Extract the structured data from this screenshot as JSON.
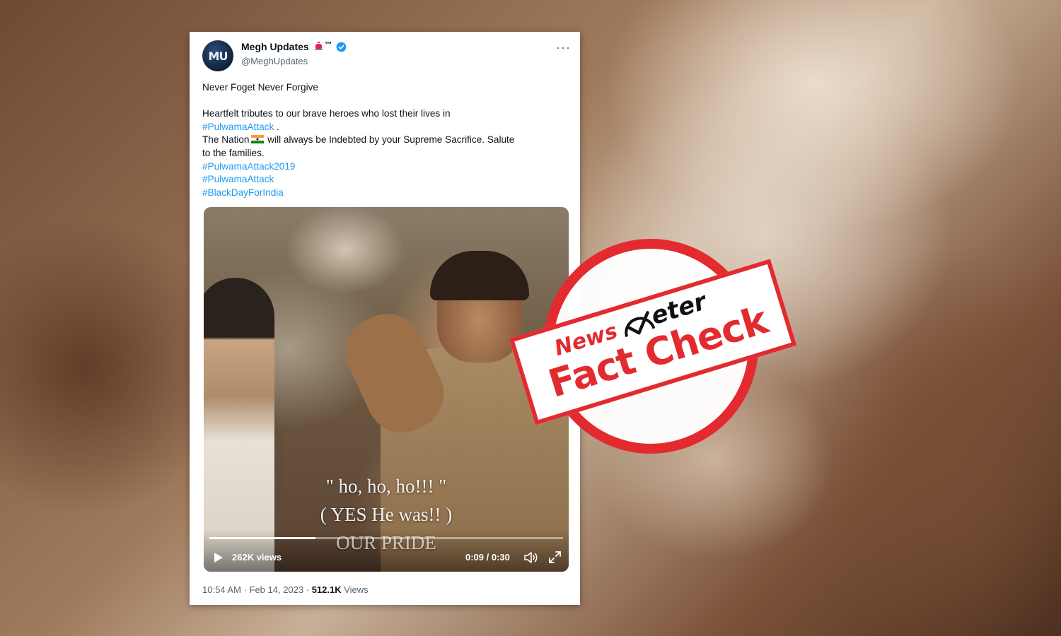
{
  "tweet": {
    "avatar_text": "MU",
    "display_name": "Megh Updates",
    "tm": "™",
    "handle": "@MeghUpdates",
    "more": "···",
    "lines": {
      "l1": "Never Foget Never Forgive",
      "l3": "Heartfelt tributes to our brave heroes who lost their lives in",
      "l4_tag": "#PulwamaAttack",
      "l4_rest": " .",
      "l5a": "The Nation",
      "l5b": " will always be Indebted by your Supreme Sacrifice. Salute",
      "l6": "to the families.",
      "l7": "#PulwamaAttack2019",
      "l8": "#PulwamaAttack",
      "l9": "#BlackDayForIndia"
    },
    "video": {
      "caption_1": "\" ho, ho, ho!!! \"",
      "caption_2": "( YES He was!! )",
      "caption_3": "OUR PRIDE",
      "views": "262K views",
      "time": "0:09 / 0:30",
      "progress": 0.3
    },
    "meta": {
      "time": "10:54 AM",
      "sep": " · ",
      "date": "Feb 14, 2023",
      "views_count": "512.1K",
      "views_label": " Views"
    }
  },
  "stamp": {
    "brand_news": "News",
    "brand_meter": "eter",
    "label": "Fact Check"
  },
  "colors": {
    "hashtag": "#1d9bf0",
    "stamp_red": "#e32b2f",
    "verified": "#1d9bf0"
  }
}
